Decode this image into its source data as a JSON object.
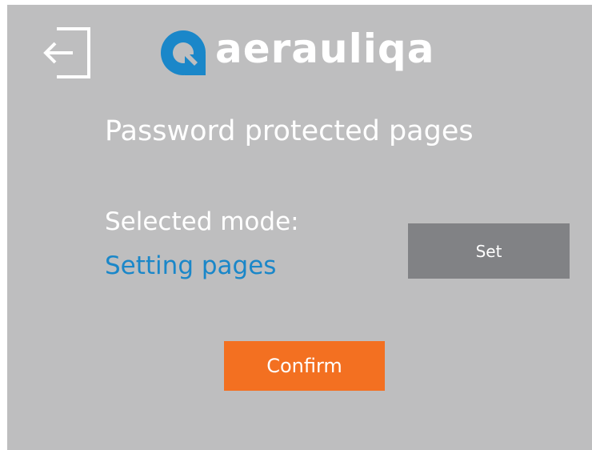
{
  "header": {
    "exit_icon": "logout-arrow-icon",
    "logo": {
      "icon": "aerauliqa-logo-mark",
      "text": "aerauliqa",
      "mark_color": "#1a87c9"
    }
  },
  "main": {
    "title": "Password protected pages",
    "selected_mode_label": "Selected mode:",
    "selected_mode_value": "Setting pages",
    "set_button_label": "Set",
    "confirm_button_label": "Confirm"
  },
  "colors": {
    "background": "#bebebf",
    "accent_blue": "#1a87c9",
    "set_button": "#818285",
    "confirm_button": "#f37021",
    "text": "#ffffff"
  }
}
